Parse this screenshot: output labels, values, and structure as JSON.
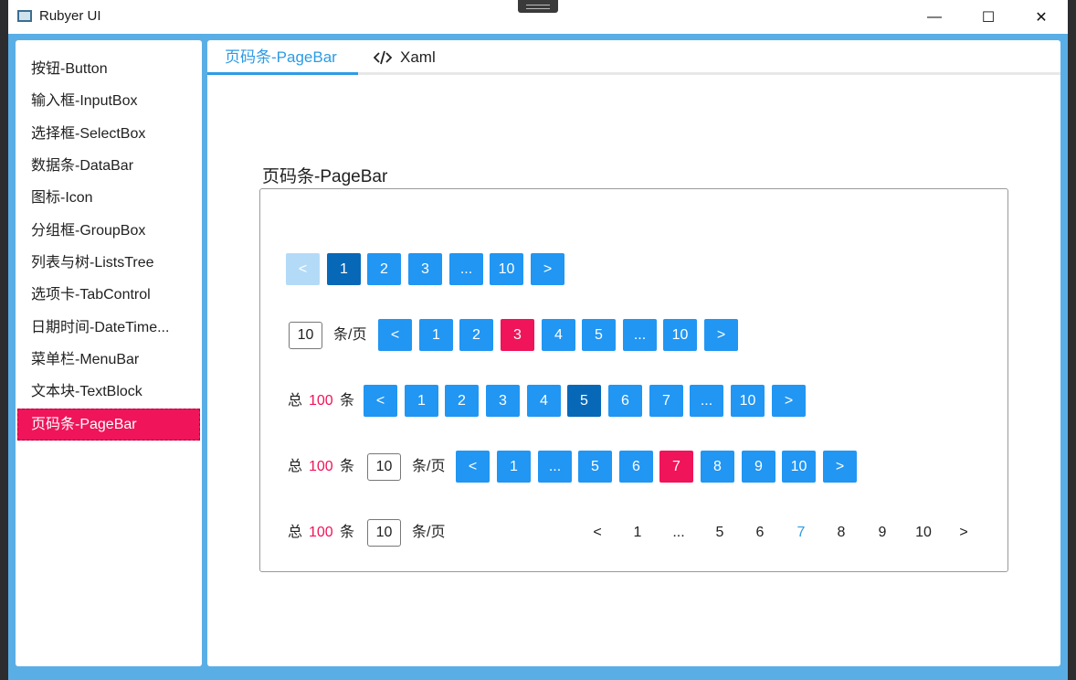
{
  "window": {
    "title": "Rubyer UI",
    "minimize": "—",
    "maximize": "☐",
    "close": "✕"
  },
  "sidebar": {
    "items": [
      {
        "label": "按钮-Button"
      },
      {
        "label": "输入框-InputBox"
      },
      {
        "label": "选择框-SelectBox"
      },
      {
        "label": "数据条-DataBar"
      },
      {
        "label": "图标-Icon"
      },
      {
        "label": "分组框-GroupBox"
      },
      {
        "label": "列表与树-ListsTree"
      },
      {
        "label": "选项卡-TabControl"
      },
      {
        "label": "日期时间-DateTime..."
      },
      {
        "label": "菜单栏-MenuBar"
      },
      {
        "label": "文本块-TextBlock"
      },
      {
        "label": "页码条-PageBar"
      }
    ],
    "active_index": 11
  },
  "tabs": [
    {
      "label": "页码条-PageBar"
    },
    {
      "label": "Xaml"
    }
  ],
  "section": {
    "title": "页码条-PageBar"
  },
  "colors": {
    "accent": "#2196f3",
    "current_dark": "#0868b8",
    "current_pink": "#f0145a",
    "disabled": "#b3dbf8"
  },
  "pagebar1": {
    "buttons": [
      "<",
      "1",
      "2",
      "3",
      "...",
      "10",
      ">"
    ]
  },
  "pagebar2": {
    "page_size": "10",
    "per_page_label": "条/页",
    "buttons": [
      "<",
      "1",
      "2",
      "3",
      "4",
      "5",
      "...",
      "10",
      ">"
    ]
  },
  "pagebar3": {
    "total_prefix": "总",
    "total": "100",
    "total_suffix": "条",
    "buttons": [
      "<",
      "1",
      "2",
      "3",
      "4",
      "5",
      "6",
      "7",
      "...",
      "10",
      ">"
    ]
  },
  "pagebar4": {
    "total_prefix": "总",
    "total": "100",
    "total_suffix": "条",
    "page_size": "10",
    "per_page_label": "条/页",
    "buttons": [
      "<",
      "1",
      "...",
      "5",
      "6",
      "7",
      "8",
      "9",
      "10",
      ">"
    ]
  },
  "pagebar5": {
    "total_prefix": "总",
    "total": "100",
    "total_suffix": "条",
    "page_size": "10",
    "per_page_label": "条/页",
    "buttons": [
      "<",
      "1",
      "...",
      "5",
      "6",
      "7",
      "8",
      "9",
      "10",
      ">"
    ]
  }
}
